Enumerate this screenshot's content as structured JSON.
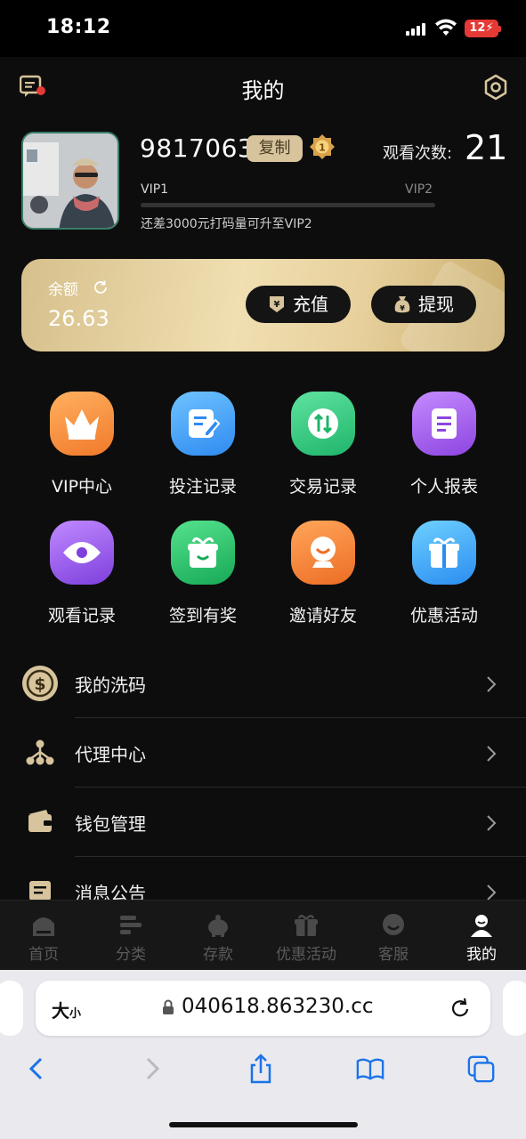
{
  "status": {
    "time": "18:12",
    "battery": "12"
  },
  "header": {
    "title": "我的"
  },
  "profile": {
    "user_id": "9817063",
    "copy_label": "复制",
    "watch_label": "观看次数:",
    "watch_count": "21",
    "vip_current": "VIP1",
    "vip_next": "VIP2",
    "vip_progress": 0.0,
    "upgrade_hint": "还差3000元打码量可升至VIP2"
  },
  "balance": {
    "label": "余额",
    "value": "26.63",
    "deposit_label": "充值",
    "withdraw_label": "提现"
  },
  "grid": [
    {
      "label": "VIP中心",
      "icon": "crown-icon",
      "color": "#f0903a"
    },
    {
      "label": "投注记录",
      "icon": "edit-note-icon",
      "color": "#3aa0f0"
    },
    {
      "label": "交易记录",
      "icon": "swap-arrows-icon",
      "color": "#2fcf7f"
    },
    {
      "label": "个人报表",
      "icon": "report-icon",
      "color": "#a35ae8"
    },
    {
      "label": "观看记录",
      "icon": "eye-icon",
      "color": "#9a4fe6"
    },
    {
      "label": "签到有奖",
      "icon": "gift-box-icon",
      "color": "#26c26a"
    },
    {
      "label": "邀请好友",
      "icon": "webcam-icon",
      "color": "#f28a3a"
    },
    {
      "label": "优惠活动",
      "icon": "gift-icon",
      "color": "#3aa6f2"
    }
  ],
  "menu": [
    {
      "label": "我的洗码",
      "icon": "coin-icon"
    },
    {
      "label": "代理中心",
      "icon": "network-icon"
    },
    {
      "label": "钱包管理",
      "icon": "wallet-icon"
    },
    {
      "label": "消息公告",
      "icon": "notice-icon"
    }
  ],
  "tabs": [
    {
      "label": "首页",
      "icon": "home-icon"
    },
    {
      "label": "分类",
      "icon": "category-icon"
    },
    {
      "label": "存款",
      "icon": "piggy-bank-icon"
    },
    {
      "label": "优惠活动",
      "icon": "gift-icon"
    },
    {
      "label": "客服",
      "icon": "support-icon"
    },
    {
      "label": "我的",
      "icon": "user-icon",
      "active": true
    }
  ],
  "browser": {
    "text_size_big": "大",
    "text_size_small": "小",
    "url": "040618.863230.cc"
  }
}
